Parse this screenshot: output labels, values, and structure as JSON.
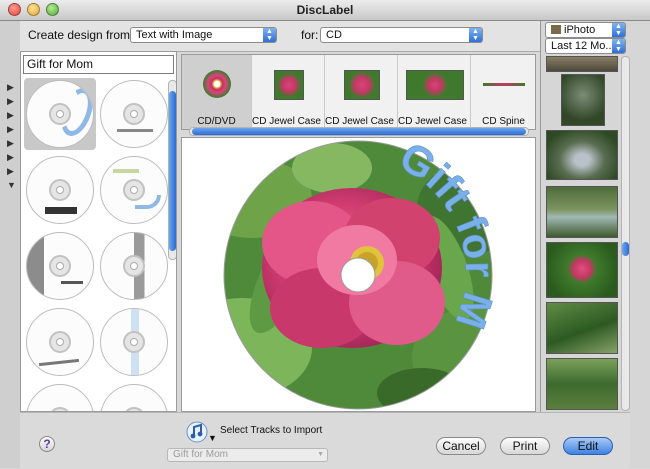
{
  "window": {
    "title": "DiscLabel"
  },
  "toolbar": {
    "design_label": "Create design from:",
    "design_value": "Text with Image",
    "for_label": "for:",
    "for_value": "CD"
  },
  "media": {
    "source": "iPhoto",
    "range": "Last 12 Mo..."
  },
  "search": {
    "value": "Gift for Mom"
  },
  "formats": [
    {
      "label": "CD/DVD"
    },
    {
      "label": "CD Jewel Case ..."
    },
    {
      "label": "CD Jewel Case ..."
    },
    {
      "label": "CD Jewel Case ..."
    },
    {
      "label": "CD Spine"
    }
  ],
  "disc": {
    "label_text": "Gift for Mom",
    "text_color": "#79b0ea"
  },
  "bottom": {
    "tracks_label": "Select Tracks to Import",
    "playlist_value": "Gift for Mom",
    "help_label": "?",
    "cancel_label": "Cancel",
    "print_label": "Print",
    "edit_label": "Edit"
  },
  "colors": {
    "accent": "#3f82e0",
    "window_bg": "#e3e3e3"
  }
}
